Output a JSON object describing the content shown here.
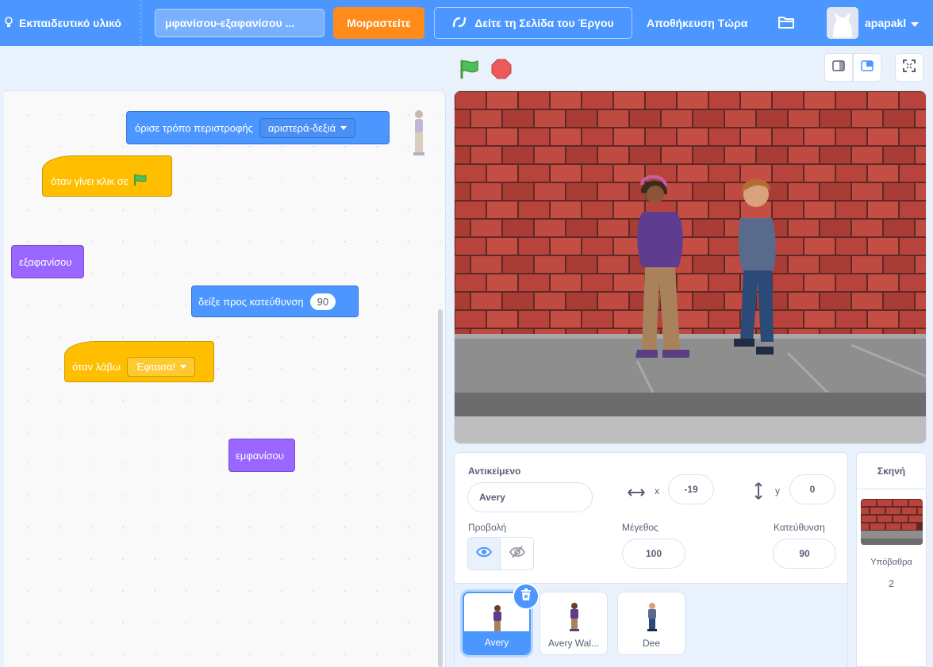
{
  "menu": {
    "tutorials_label": "Εκπαιδευτικό υλικό",
    "project_title": "μφανίσου-εξαφανίσου ...",
    "share_label": "Μοιραστείτε",
    "see_project_label": "Δείτε τη Σελίδα του Έργου",
    "save_now_label": "Αποθήκευση Τώρα",
    "username": "apapakl"
  },
  "blocks": {
    "rotation_style_text": "όρισε τρόπο περιστροφής",
    "rotation_style_value": "αριστερά-δεξιά",
    "when_flag_text": "όταν γίνει κλικ σε",
    "hide_text": "εξαφανίσου",
    "point_direction_text": "δείξε προς κατεύθυνση",
    "point_direction_value": "90",
    "when_receive_text": "όταν λάβω",
    "when_receive_value": "Έφτασα!",
    "show_text": "εμφανίσου"
  },
  "sprite_info": {
    "header": "Αντικείμενο",
    "name": "Avery",
    "x_label": "x",
    "x_value": "-19",
    "y_label": "y",
    "y_value": "0",
    "show_label": "Προβολή",
    "size_label": "Μέγεθος",
    "size_value": "100",
    "direction_label": "Κατεύθυνση",
    "direction_value": "90"
  },
  "sprites": [
    {
      "name": "Avery",
      "selected": true
    },
    {
      "name": "Avery Wal...",
      "selected": false
    },
    {
      "name": "Dee",
      "selected": false
    }
  ],
  "stage_pane": {
    "title": "Σκηνή",
    "backdrops_label": "Υπόβαθρα",
    "backdrops_count": "2"
  },
  "colors": {
    "menubar": "#4c97ff",
    "share": "#ff8c1a",
    "motion": "#4c97ff",
    "looks": "#9966ff",
    "events": "#ffbf00",
    "flag": "#4cbf56",
    "stop": "#ec5959"
  },
  "icons": [
    "lightbulb-icon",
    "remix-icon",
    "folder-icon",
    "green-flag-icon",
    "stop-icon",
    "small-stage-icon",
    "normal-stage-icon",
    "fullscreen-icon",
    "arrows-horizontal-icon",
    "arrows-vertical-icon",
    "eye-icon",
    "eye-slash-icon",
    "trash-icon"
  ]
}
